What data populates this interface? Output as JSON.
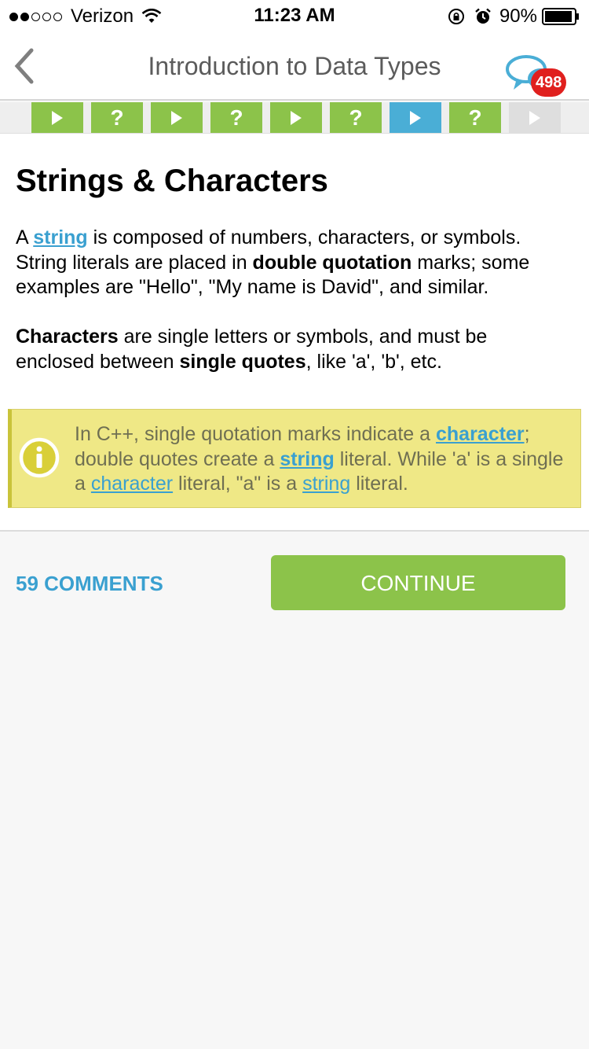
{
  "status_bar": {
    "carrier": "Verizon",
    "time": "11:23 AM",
    "battery": "90%",
    "signal_bars_filled": 2,
    "signal_bars_total": 5
  },
  "header": {
    "title": "Introduction to Data Types",
    "badge_count": "498",
    "icons": {
      "back": "chevron-left-icon",
      "chat": "chat-bubbles-icon"
    }
  },
  "progress": {
    "steps": [
      {
        "type": "play",
        "state": "done",
        "label": ""
      },
      {
        "type": "quiz",
        "state": "done",
        "label": "?"
      },
      {
        "type": "play",
        "state": "done",
        "label": ""
      },
      {
        "type": "quiz",
        "state": "done",
        "label": "?"
      },
      {
        "type": "play",
        "state": "done",
        "label": ""
      },
      {
        "type": "quiz",
        "state": "done",
        "label": "?"
      },
      {
        "type": "play",
        "state": "current",
        "label": ""
      },
      {
        "type": "quiz",
        "state": "done",
        "label": "?"
      },
      {
        "type": "play",
        "state": "locked",
        "label": ""
      }
    ],
    "colors": {
      "done": "#8cc34a",
      "current": "#4aaed6",
      "locked": "#dedede"
    }
  },
  "lesson": {
    "title": "Strings & Characters",
    "p1": {
      "t1": "A ",
      "link1": "string",
      "t2": " is composed of numbers, characters, or symbols. String literals are placed in ",
      "b1": "double quotation",
      "t3": " marks; some examples are \"Hello\", \"My name is David\", and similar."
    },
    "p2": {
      "b1": "Characters",
      "t1": " are single letters or symbols, and must be enclosed between ",
      "b2": "single quotes",
      "t2": ", like 'a', 'b', etc."
    },
    "note": {
      "icon": "info-icon",
      "t1": "In C++, single quotation marks indicate a ",
      "link1": "character",
      "t2": "; double quotes create a ",
      "link2": "string",
      "t3": " literal. While 'a' is a single a ",
      "link3": "character",
      "t4": " literal, \"a\" is a ",
      "link4": "string",
      "t5": " literal."
    }
  },
  "footer": {
    "comments": "59 COMMENTS",
    "continue": "CONTINUE"
  },
  "colors": {
    "accent_blue": "#3aa0d0",
    "accent_green": "#8cc34a",
    "note_bg": "#efe886",
    "badge_red": "#e0201e"
  }
}
